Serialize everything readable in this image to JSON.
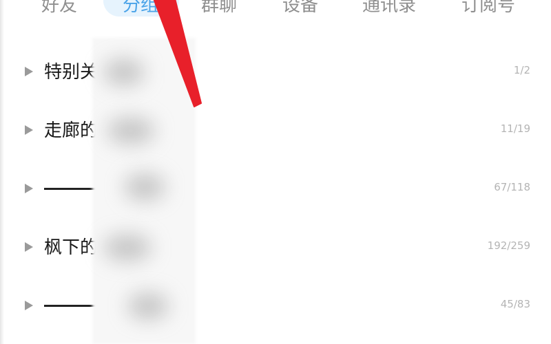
{
  "tabs": [
    {
      "label": "好友",
      "active": false
    },
    {
      "label": "分组",
      "active": true
    },
    {
      "label": "群聊",
      "active": false
    },
    {
      "label": "设备",
      "active": false
    },
    {
      "label": "通讯录",
      "active": false
    },
    {
      "label": "订阅号",
      "active": false
    }
  ],
  "groups": [
    {
      "name": "特别关",
      "count": "1/2"
    },
    {
      "name": "走廊的",
      "count": "11/19"
    },
    {
      "name": "",
      "count": "67/118"
    },
    {
      "name": "枫下的",
      "count": "192/259"
    },
    {
      "name": "",
      "count": "45/83"
    }
  ],
  "colors": {
    "active_tab": "#4aa3e8",
    "annotation_arrow": "#e8202a"
  },
  "icons": {
    "expand": "caret-right-icon",
    "annotation": "red-arrow-annotation"
  }
}
